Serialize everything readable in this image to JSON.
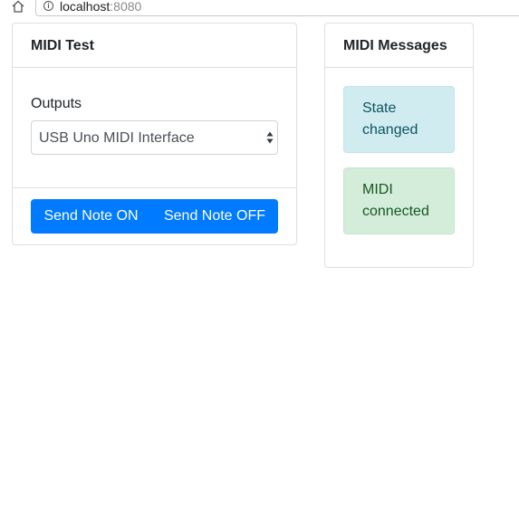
{
  "browser": {
    "url_host": "localhost",
    "url_port": ":8080"
  },
  "midi_test": {
    "title": "MIDI Test",
    "outputs_label": "Outputs",
    "selected_output": "USB Uno MIDI Interface",
    "send_on_label": "Send Note ON",
    "send_off_label": "Send Note OFF",
    "accent_color": "#007bff"
  },
  "midi_messages": {
    "title": "MIDI Messages",
    "items": [
      {
        "text": "State changed",
        "status": "info",
        "color": "#d1ecf1"
      },
      {
        "text": "MIDI connected",
        "status": "success",
        "color": "#d4edda"
      }
    ]
  }
}
